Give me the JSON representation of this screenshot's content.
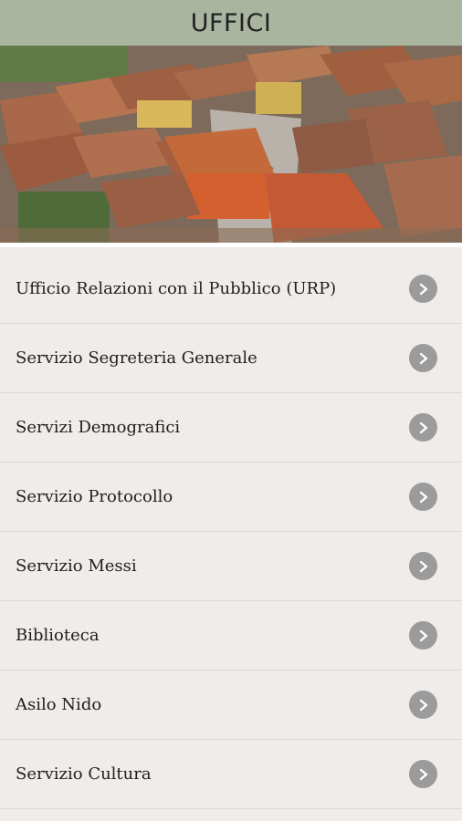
{
  "header": {
    "title": "UFFICI"
  },
  "hero": {
    "image": "aerial view of town rooftops"
  },
  "menu": {
    "items": [
      {
        "label": "Ufficio Relazioni con il Pubblico (URP)",
        "icon": "chevron-right-icon"
      },
      {
        "label": "Servizio Segreteria Generale",
        "icon": "chevron-right-icon"
      },
      {
        "label": "Servizi Demografici",
        "icon": "chevron-right-icon"
      },
      {
        "label": "Servizio Protocollo",
        "icon": "chevron-right-icon"
      },
      {
        "label": "Servizio Messi",
        "icon": "chevron-right-icon"
      },
      {
        "label": "Biblioteca",
        "icon": "chevron-right-icon"
      },
      {
        "label": "Asilo Nido",
        "icon": "chevron-right-icon"
      },
      {
        "label": "Servizio Cultura",
        "icon": "chevron-right-icon"
      }
    ]
  },
  "colors": {
    "header_bg": "#a9b59f",
    "page_bg": "#efecea",
    "chevron_bg": "#9b9b9b"
  }
}
